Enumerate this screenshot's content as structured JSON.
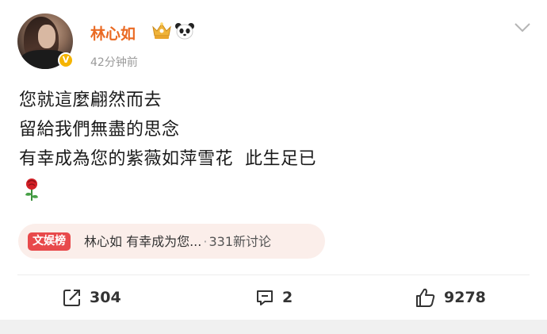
{
  "post": {
    "author": {
      "name": "林心如",
      "verified_mark": "V",
      "badges": [
        "crown-icon",
        "panda-icon"
      ]
    },
    "timestamp": "42分钟前",
    "text_lines": [
      "您就這麼翩然而去",
      "留給我們無盡的思念",
      "有幸成為您的紫薇如萍雪花  此生足已"
    ],
    "emoji": "rose-icon",
    "topic": {
      "badge": "文娱榜",
      "title": "林心如 有幸成为您...",
      "separator": "·",
      "discussion": "331新讨论"
    },
    "actions": {
      "repost_count": "304",
      "comment_count": "2",
      "like_count": "9278"
    }
  },
  "colors": {
    "username": "#ea6a23",
    "verified": "#f5b400",
    "topic_badge": "#e8494b",
    "topic_bg": "#fbeeea",
    "icon_gray": "#333333"
  }
}
